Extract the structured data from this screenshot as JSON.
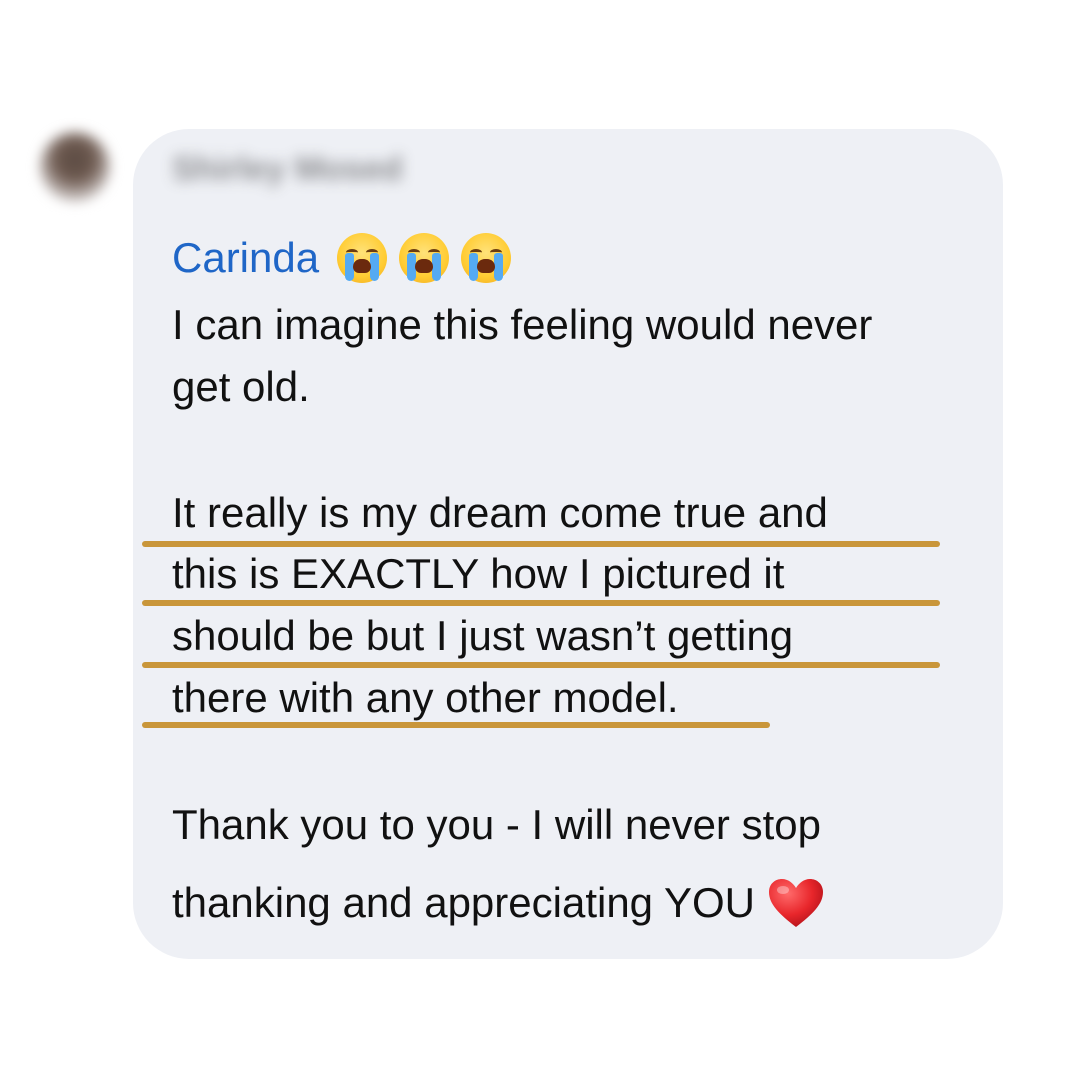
{
  "comment": {
    "author_name": "Shirley Mosed",
    "mention": "Carinda",
    "mention_emojis": [
      "crying-face",
      "crying-face",
      "crying-face"
    ],
    "lines": [
      "I can imagine this feeling would never",
      "get old.",
      "It really is my dream come true and",
      "this is EXACTLY how I pictured it",
      "should be but I just wasn’t getting",
      "there with any other model.",
      "Thank you to you - I will never stop",
      "thanking and appreciating YOU"
    ],
    "end_emoji": "red-heart",
    "colors": {
      "bubble": "#eef0f5",
      "mention": "#1f66c7",
      "text": "#111111",
      "highlight": "#c9963a"
    }
  }
}
